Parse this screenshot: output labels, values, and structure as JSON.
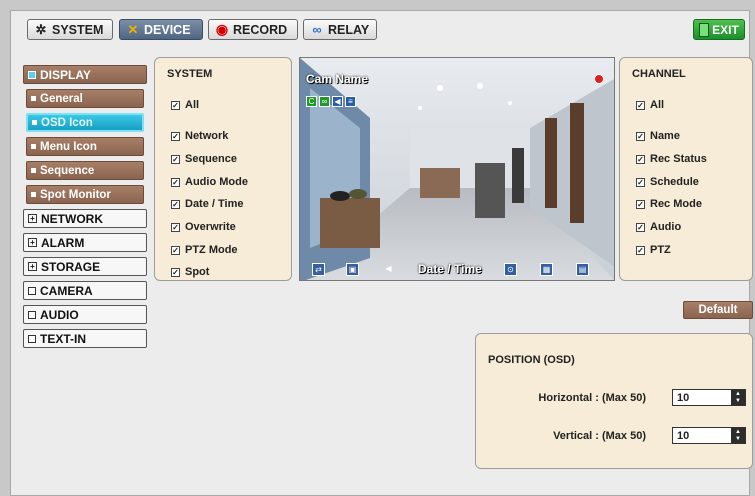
{
  "tabs": [
    {
      "label": "SYSTEM",
      "icon": "gear-icon",
      "active": false
    },
    {
      "label": "DEVICE",
      "icon": "tools-icon",
      "active": true
    },
    {
      "label": "RECORD",
      "icon": "record-icon",
      "active": false
    },
    {
      "label": "RELAY",
      "icon": "link-icon",
      "active": false
    }
  ],
  "exit_label": "EXIT",
  "sidebar": {
    "items": [
      {
        "label": "DISPLAY",
        "style": "brown",
        "marker": "dot"
      },
      {
        "label": "General",
        "style": "sub",
        "marker": "bullet"
      },
      {
        "label": "OSD Icon",
        "style": "selected",
        "marker": "bullet"
      },
      {
        "label": "Menu Icon",
        "style": "sub",
        "marker": "bullet"
      },
      {
        "label": "Sequence",
        "style": "sub",
        "marker": "bullet"
      },
      {
        "label": "Spot Monitor",
        "style": "sub",
        "marker": "bullet"
      },
      {
        "label": "NETWORK",
        "style": "plain",
        "marker": "plus"
      },
      {
        "label": "ALARM",
        "style": "plain",
        "marker": "plus"
      },
      {
        "label": "STORAGE",
        "style": "plain",
        "marker": "plus"
      },
      {
        "label": "CAMERA",
        "style": "plain",
        "marker": "square"
      },
      {
        "label": "AUDIO",
        "style": "plain",
        "marker": "square"
      },
      {
        "label": "TEXT-IN",
        "style": "plain",
        "marker": "square"
      }
    ]
  },
  "system_panel": {
    "title": "SYSTEM",
    "items": [
      "All",
      "Network",
      "Sequence",
      "Audio Mode",
      "Date / Time",
      "Overwrite",
      "PTZ Mode",
      "Spot"
    ]
  },
  "preview": {
    "cam_name": "Cam Name",
    "date_time": "Date / Time",
    "status_icons": [
      "C",
      "∞",
      "◀",
      "≡"
    ]
  },
  "channel_panel": {
    "title": "CHANNEL",
    "items": [
      "All",
      "Name",
      "Rec Status",
      "Schedule",
      "Rec Mode",
      "Audio",
      "PTZ"
    ]
  },
  "default_label": "Default",
  "position": {
    "title": "POSITION (OSD)",
    "horizontal_label": "Horizontal : (Max 50)",
    "horizontal_value": "10",
    "vertical_label": "Vertical : (Max 50)",
    "vertical_value": "10"
  },
  "colors": {
    "accent_brown": "#8b6450",
    "selected_cyan": "#1a9ec2",
    "exit_green": "#1b8f2a",
    "panel_bg": "#f6ecd7"
  }
}
